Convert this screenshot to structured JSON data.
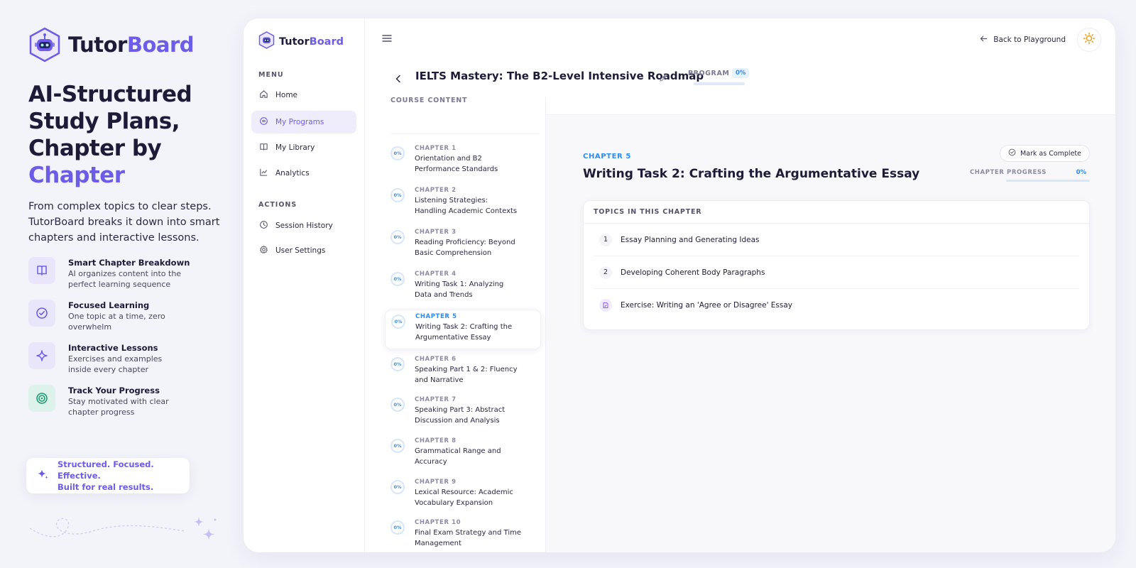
{
  "promo": {
    "brand_a": "Tutor",
    "brand_b": "Board",
    "headline_1": "AI-Structured",
    "headline_2": "Study Plans,",
    "headline_3": "Chapter by",
    "headline_accent": "Chapter",
    "lead": "From complex topics to clear steps. TutorBoard breaks it down into smart chapters and interactive lessons.",
    "features": [
      {
        "title": "Smart Chapter Breakdown",
        "desc": "AI organizes content into the perfect learning sequence",
        "icon": "book-icon"
      },
      {
        "title": "Focused Learning",
        "desc": "One topic at a time, zero overwhelm",
        "icon": "check-circle-icon"
      },
      {
        "title": "Interactive Lessons",
        "desc": "Exercises and examples inside every chapter",
        "icon": "sparkle-icon"
      },
      {
        "title": "Track Your Progress",
        "desc": "Stay motivated with clear chapter progress",
        "icon": "target-icon"
      }
    ],
    "tagline_1": "Structured. Focused. Effective.",
    "tagline_2": "Built for real results."
  },
  "sidebar": {
    "brand_a": "Tutor",
    "brand_b": "Board",
    "menu_label": "MENU",
    "menu": [
      {
        "label": "Home",
        "icon": "home-icon"
      },
      {
        "label": "My Programs",
        "icon": "programs-icon",
        "active": true
      },
      {
        "label": "My Library",
        "icon": "library-icon"
      },
      {
        "label": "Analytics",
        "icon": "chart-icon"
      }
    ],
    "actions_label": "ACTIONS",
    "actions": [
      {
        "label": "Session History",
        "icon": "clock-icon"
      },
      {
        "label": "User Settings",
        "icon": "gear-icon"
      }
    ]
  },
  "topbar": {
    "back_label": "Back to Playground"
  },
  "program": {
    "title": "IELTS Mastery: The B2-Level Intensive Roadmap",
    "progress_label": "PROGRAM",
    "progress_pct": "0%"
  },
  "course": {
    "heading": "COURSE CONTENT",
    "chapters": [
      {
        "label": "CHAPTER 1",
        "name": "Orientation and B2 Performance Standards",
        "pct": "0%"
      },
      {
        "label": "CHAPTER 2",
        "name": "Listening Strategies: Handling Academic Contexts",
        "pct": "0%"
      },
      {
        "label": "CHAPTER 3",
        "name": "Reading Proficiency: Beyond Basic Comprehension",
        "pct": "0%"
      },
      {
        "label": "CHAPTER 4",
        "name": "Writing Task 1: Analyzing Data and Trends",
        "pct": "0%"
      },
      {
        "label": "CHAPTER 5",
        "name": "Writing Task 2: Crafting the Argumentative Essay",
        "pct": "0%",
        "active": true
      },
      {
        "label": "CHAPTER 6",
        "name": "Speaking Part 1 & 2: Fluency and Narrative",
        "pct": "0%"
      },
      {
        "label": "CHAPTER 7",
        "name": "Speaking Part 3: Abstract Discussion and Analysis",
        "pct": "0%"
      },
      {
        "label": "CHAPTER 8",
        "name": "Grammatical Range and Accuracy",
        "pct": "0%"
      },
      {
        "label": "CHAPTER 9",
        "name": "Lexical Resource: Academic Vocabulary Expansion",
        "pct": "0%"
      },
      {
        "label": "CHAPTER 10",
        "name": "Final Exam Strategy and Time Management",
        "pct": "0%"
      }
    ]
  },
  "chapter": {
    "label": "CHAPTER 5",
    "title": "Writing Task 2: Crafting the Argumentative Essay",
    "complete_button": "Mark as Complete",
    "progress_label": "CHAPTER PROGRESS",
    "progress_pct": "0%",
    "topics_heading": "TOPICS IN THIS CHAPTER",
    "topics": [
      {
        "num": "1",
        "title": "Essay Planning and Generating Ideas"
      },
      {
        "num": "2",
        "title": "Developing Coherent Body Paragraphs"
      },
      {
        "num": "",
        "title": "Exercise: Writing an 'Agree or Disagree' Essay",
        "icon": "exercise-icon"
      }
    ]
  },
  "colors": {
    "accent": "#6d5ce8",
    "progress_blue": "#2d8cf0",
    "text_dark": "#1e1b39"
  }
}
